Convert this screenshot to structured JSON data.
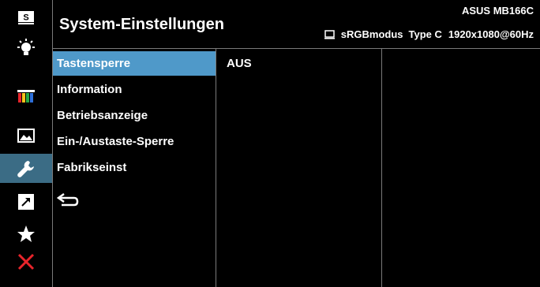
{
  "header": {
    "title": "System-Einstellungen",
    "model": "ASUS MB166C",
    "color_mode": "sRGBmodus",
    "input": "Type C",
    "resolution": "1920x1080@60Hz"
  },
  "rail": {
    "items": [
      {
        "icon": "splendid-s-icon",
        "active": false
      },
      {
        "icon": "brightness-icon",
        "active": false
      },
      {
        "icon": "color-bars-icon",
        "active": false
      },
      {
        "icon": "image-icon",
        "active": false
      },
      {
        "icon": "wrench-icon",
        "active": true
      },
      {
        "icon": "shortcut-arrow-icon",
        "active": false
      },
      {
        "icon": "star-icon",
        "active": false
      },
      {
        "icon": "close-icon",
        "active": false
      }
    ]
  },
  "menu": {
    "items": [
      {
        "label": "Tastensperre",
        "active": true
      },
      {
        "label": "Information",
        "active": false
      },
      {
        "label": "Betriebsanzeige",
        "active": false
      },
      {
        "label": "Ein-/Austaste-Sperre",
        "active": false
      },
      {
        "label": "Fabrikseinst",
        "active": false
      },
      {
        "icon": "back-icon"
      }
    ]
  },
  "values": {
    "items": [
      "AUS"
    ]
  },
  "colors": {
    "rail_active": "#3b6c85",
    "menu_active": "#4f99c9",
    "close_red": "#e8242b",
    "divider": "#7a7a7a"
  }
}
